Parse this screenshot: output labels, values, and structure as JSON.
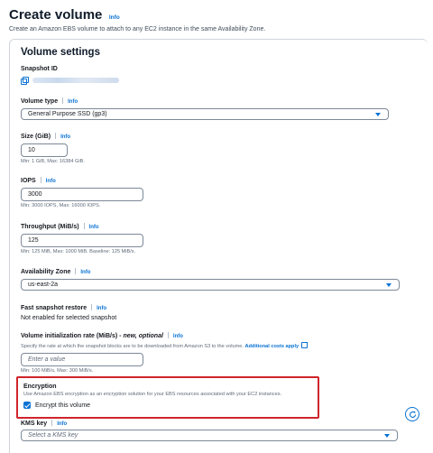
{
  "header": {
    "title": "Create volume",
    "info": "Info",
    "description": "Create an Amazon EBS volume to attach to any EC2 instance in the same Availability Zone."
  },
  "panel": {
    "title": "Volume settings",
    "snapshot": {
      "label": "Snapshot ID"
    },
    "volume_type": {
      "label": "Volume type",
      "info": "Info",
      "value": "General Purpose SSD (gp3)"
    },
    "size": {
      "label": "Size (GiB)",
      "info": "Info",
      "value": "10",
      "hint": "Min: 1 GiB, Max: 16384 GiB."
    },
    "iops": {
      "label": "IOPS",
      "info": "Info",
      "value": "3000",
      "hint": "Min: 3000 IOPS, Max: 16000 IOPS."
    },
    "throughput": {
      "label": "Throughput (MiB/s)",
      "info": "Info",
      "value": "125",
      "hint": "Min: 125 MiB, Max: 1000 MiB. Baseline: 125 MiB/s."
    },
    "availability_zone": {
      "label": "Availability Zone",
      "info": "Info",
      "value": "us-east-2a"
    },
    "fast_snapshot_restore": {
      "label": "Fast snapshot restore",
      "info": "Info",
      "value": "Not enabled for selected snapshot"
    },
    "init_rate": {
      "label": "Volume initialization rate (MiB/s)",
      "optional": "- new, optional",
      "info": "Info",
      "description": "Specify the rate at which the snapshot blocks are to be downloaded from Amazon S3 to the volume.",
      "link": "Additional costs apply",
      "placeholder": "Enter a value",
      "hint": "Min: 100 MiB/s, Max: 300 MiB/s."
    },
    "encryption": {
      "title": "Encryption",
      "description": "Use Amazon EBS encryption as an encryption solution for your EBS resources associated with your EC2 instances.",
      "checkbox_label": "Encrypt this volume",
      "checked": true
    },
    "kms_key": {
      "label": "KMS key",
      "info": "Info",
      "placeholder": "Select a KMS key"
    }
  },
  "colors": {
    "accent": "#0972d3",
    "highlight_border": "#d0242b"
  }
}
